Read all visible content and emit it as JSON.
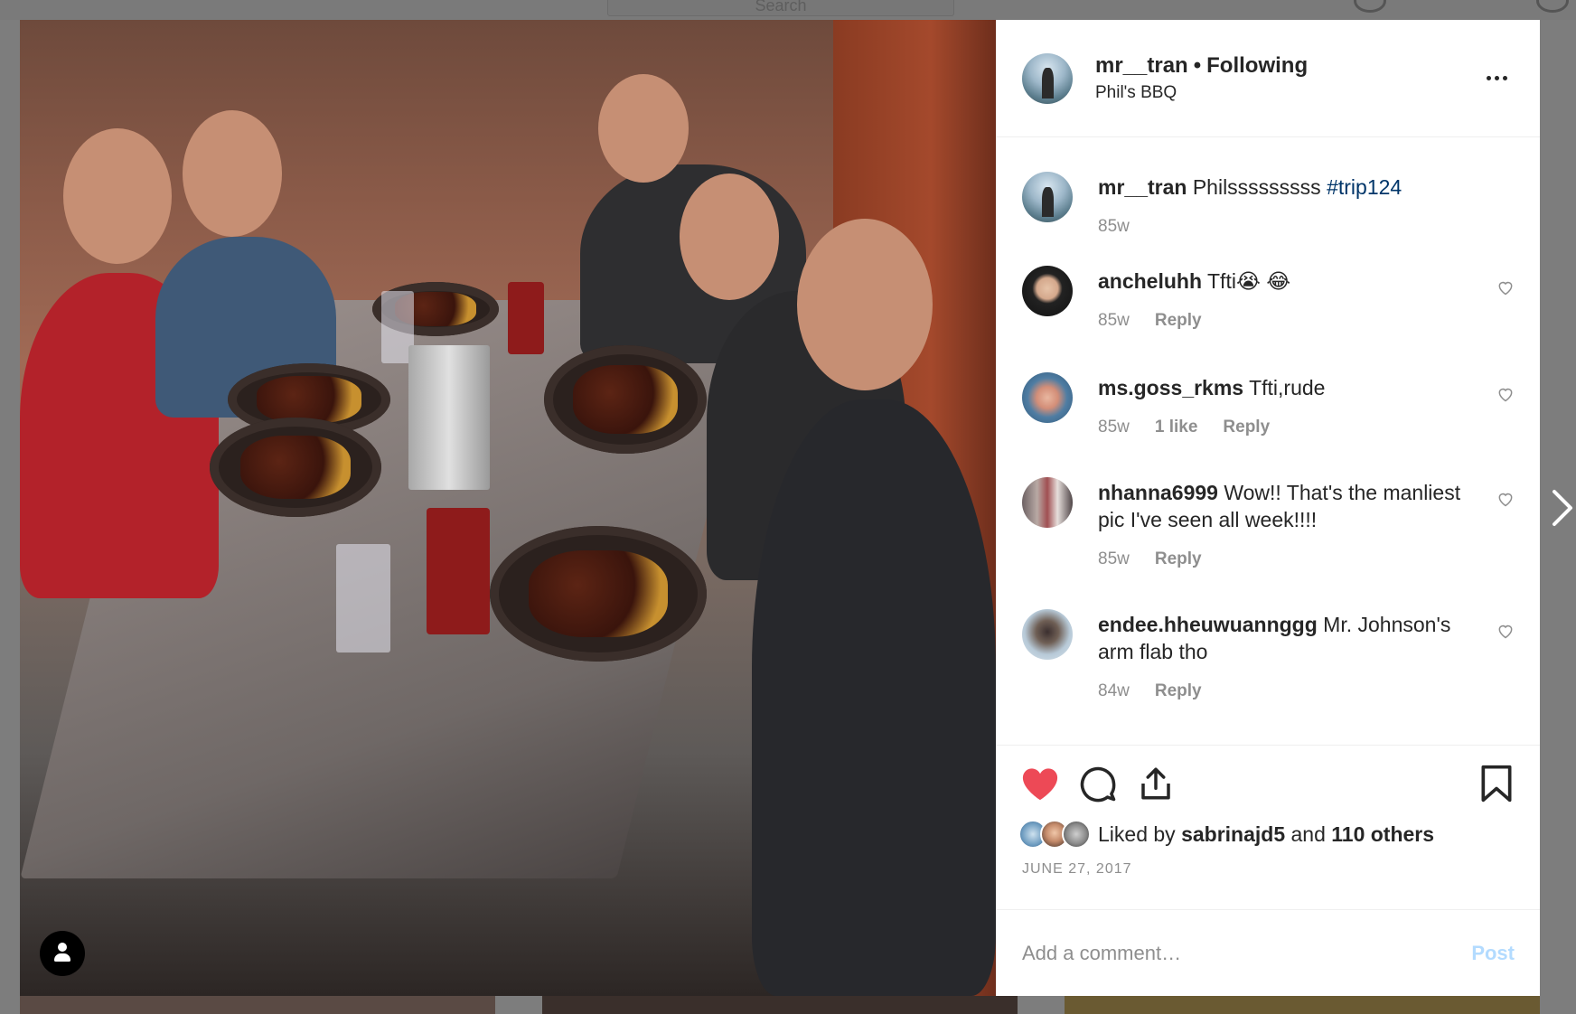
{
  "post": {
    "author": "mr__tran",
    "separator": "•",
    "follow_status": "Following",
    "location": "Phil's BBQ",
    "more_icon": "more-horizontal-icon"
  },
  "caption": {
    "username": "mr__tran",
    "text": "Philsssssssss ",
    "hashtag": "#trip124",
    "time": "85w"
  },
  "comments": [
    {
      "username": "ancheluhh",
      "text": "Tfti😭 😂",
      "time": "85w",
      "likes": "",
      "reply": "Reply"
    },
    {
      "username": "ms.goss_rkms",
      "text": "Tfti,rude",
      "time": "85w",
      "likes": "1 like",
      "reply": "Reply"
    },
    {
      "username": "nhanna6999",
      "text": "Wow!! That's the manliest pic I've seen all week!!!!",
      "time": "85w",
      "likes": "",
      "reply": "Reply"
    },
    {
      "username": "endee.hheuwuannggg",
      "text": "Mr. Johnson's arm flab tho",
      "time": "84w",
      "likes": "",
      "reply": "Reply"
    }
  ],
  "likes": {
    "prefix": "Liked by ",
    "user": "sabrinajd5",
    "middle": " and ",
    "others": "110 others"
  },
  "date": "JUNE 27, 2017",
  "add_comment": {
    "placeholder": "Add a comment…",
    "post_label": "Post"
  },
  "background": {
    "search_placeholder": "Search"
  },
  "colors": {
    "heart_liked": "#ed4956",
    "hashtag": "#003569",
    "post_disabled": "#b3dbff",
    "muted_text": "#8e8e8e"
  }
}
